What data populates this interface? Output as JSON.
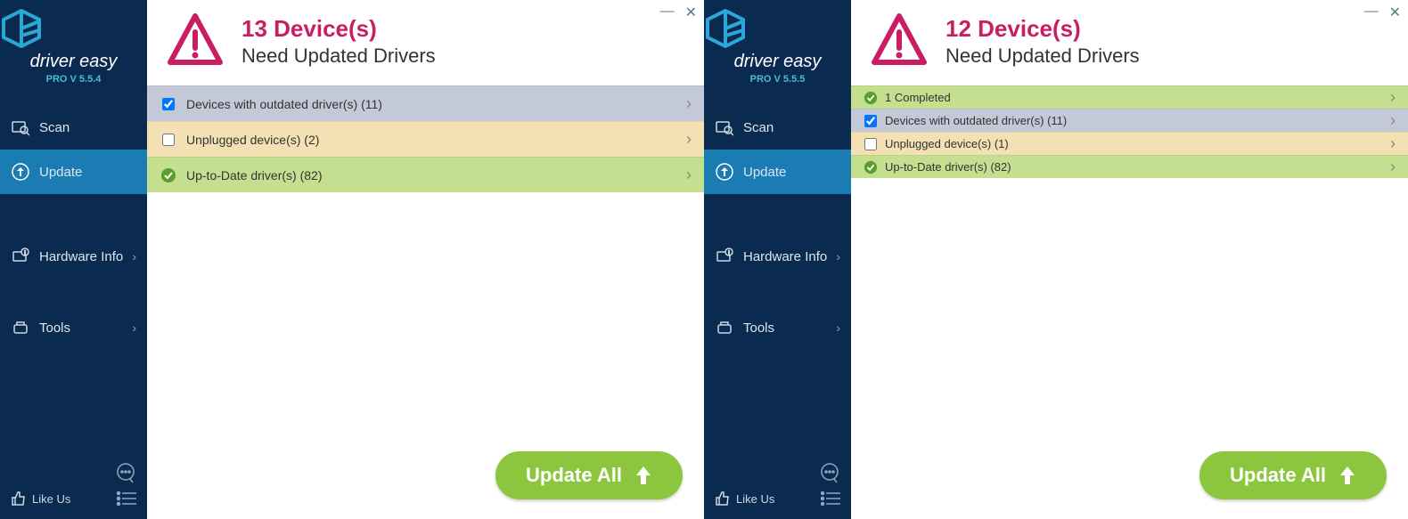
{
  "apps": [
    {
      "brand": "driver easy",
      "version": "PRO V 5.5.4",
      "nav": {
        "scan": "Scan",
        "update": "Update",
        "hardware": "Hardware Info",
        "tools": "Tools"
      },
      "like": "Like Us",
      "header": {
        "count": "13 Device(s)",
        "sub": "Need Updated Drivers"
      },
      "cats": {
        "outdated": "Devices with outdated driver(s) (11)",
        "unplugged": "Unplugged device(s) (2)",
        "uptodate": "Up-to-Date driver(s) (82)"
      },
      "updateAll": "Update All"
    },
    {
      "brand": "driver easy",
      "version": "PRO V 5.5.5",
      "nav": {
        "scan": "Scan",
        "update": "Update",
        "hardware": "Hardware Info",
        "tools": "Tools"
      },
      "like": "Like Us",
      "header": {
        "count": "12 Device(s)",
        "sub": "Need Updated Drivers"
      },
      "cats": {
        "completed": "1 Completed",
        "outdated": "Devices with outdated driver(s) (11)",
        "unplugged": "Unplugged device(s) (1)",
        "uptodate": "Up-to-Date driver(s) (82)"
      },
      "updateAll": "Update All"
    }
  ]
}
